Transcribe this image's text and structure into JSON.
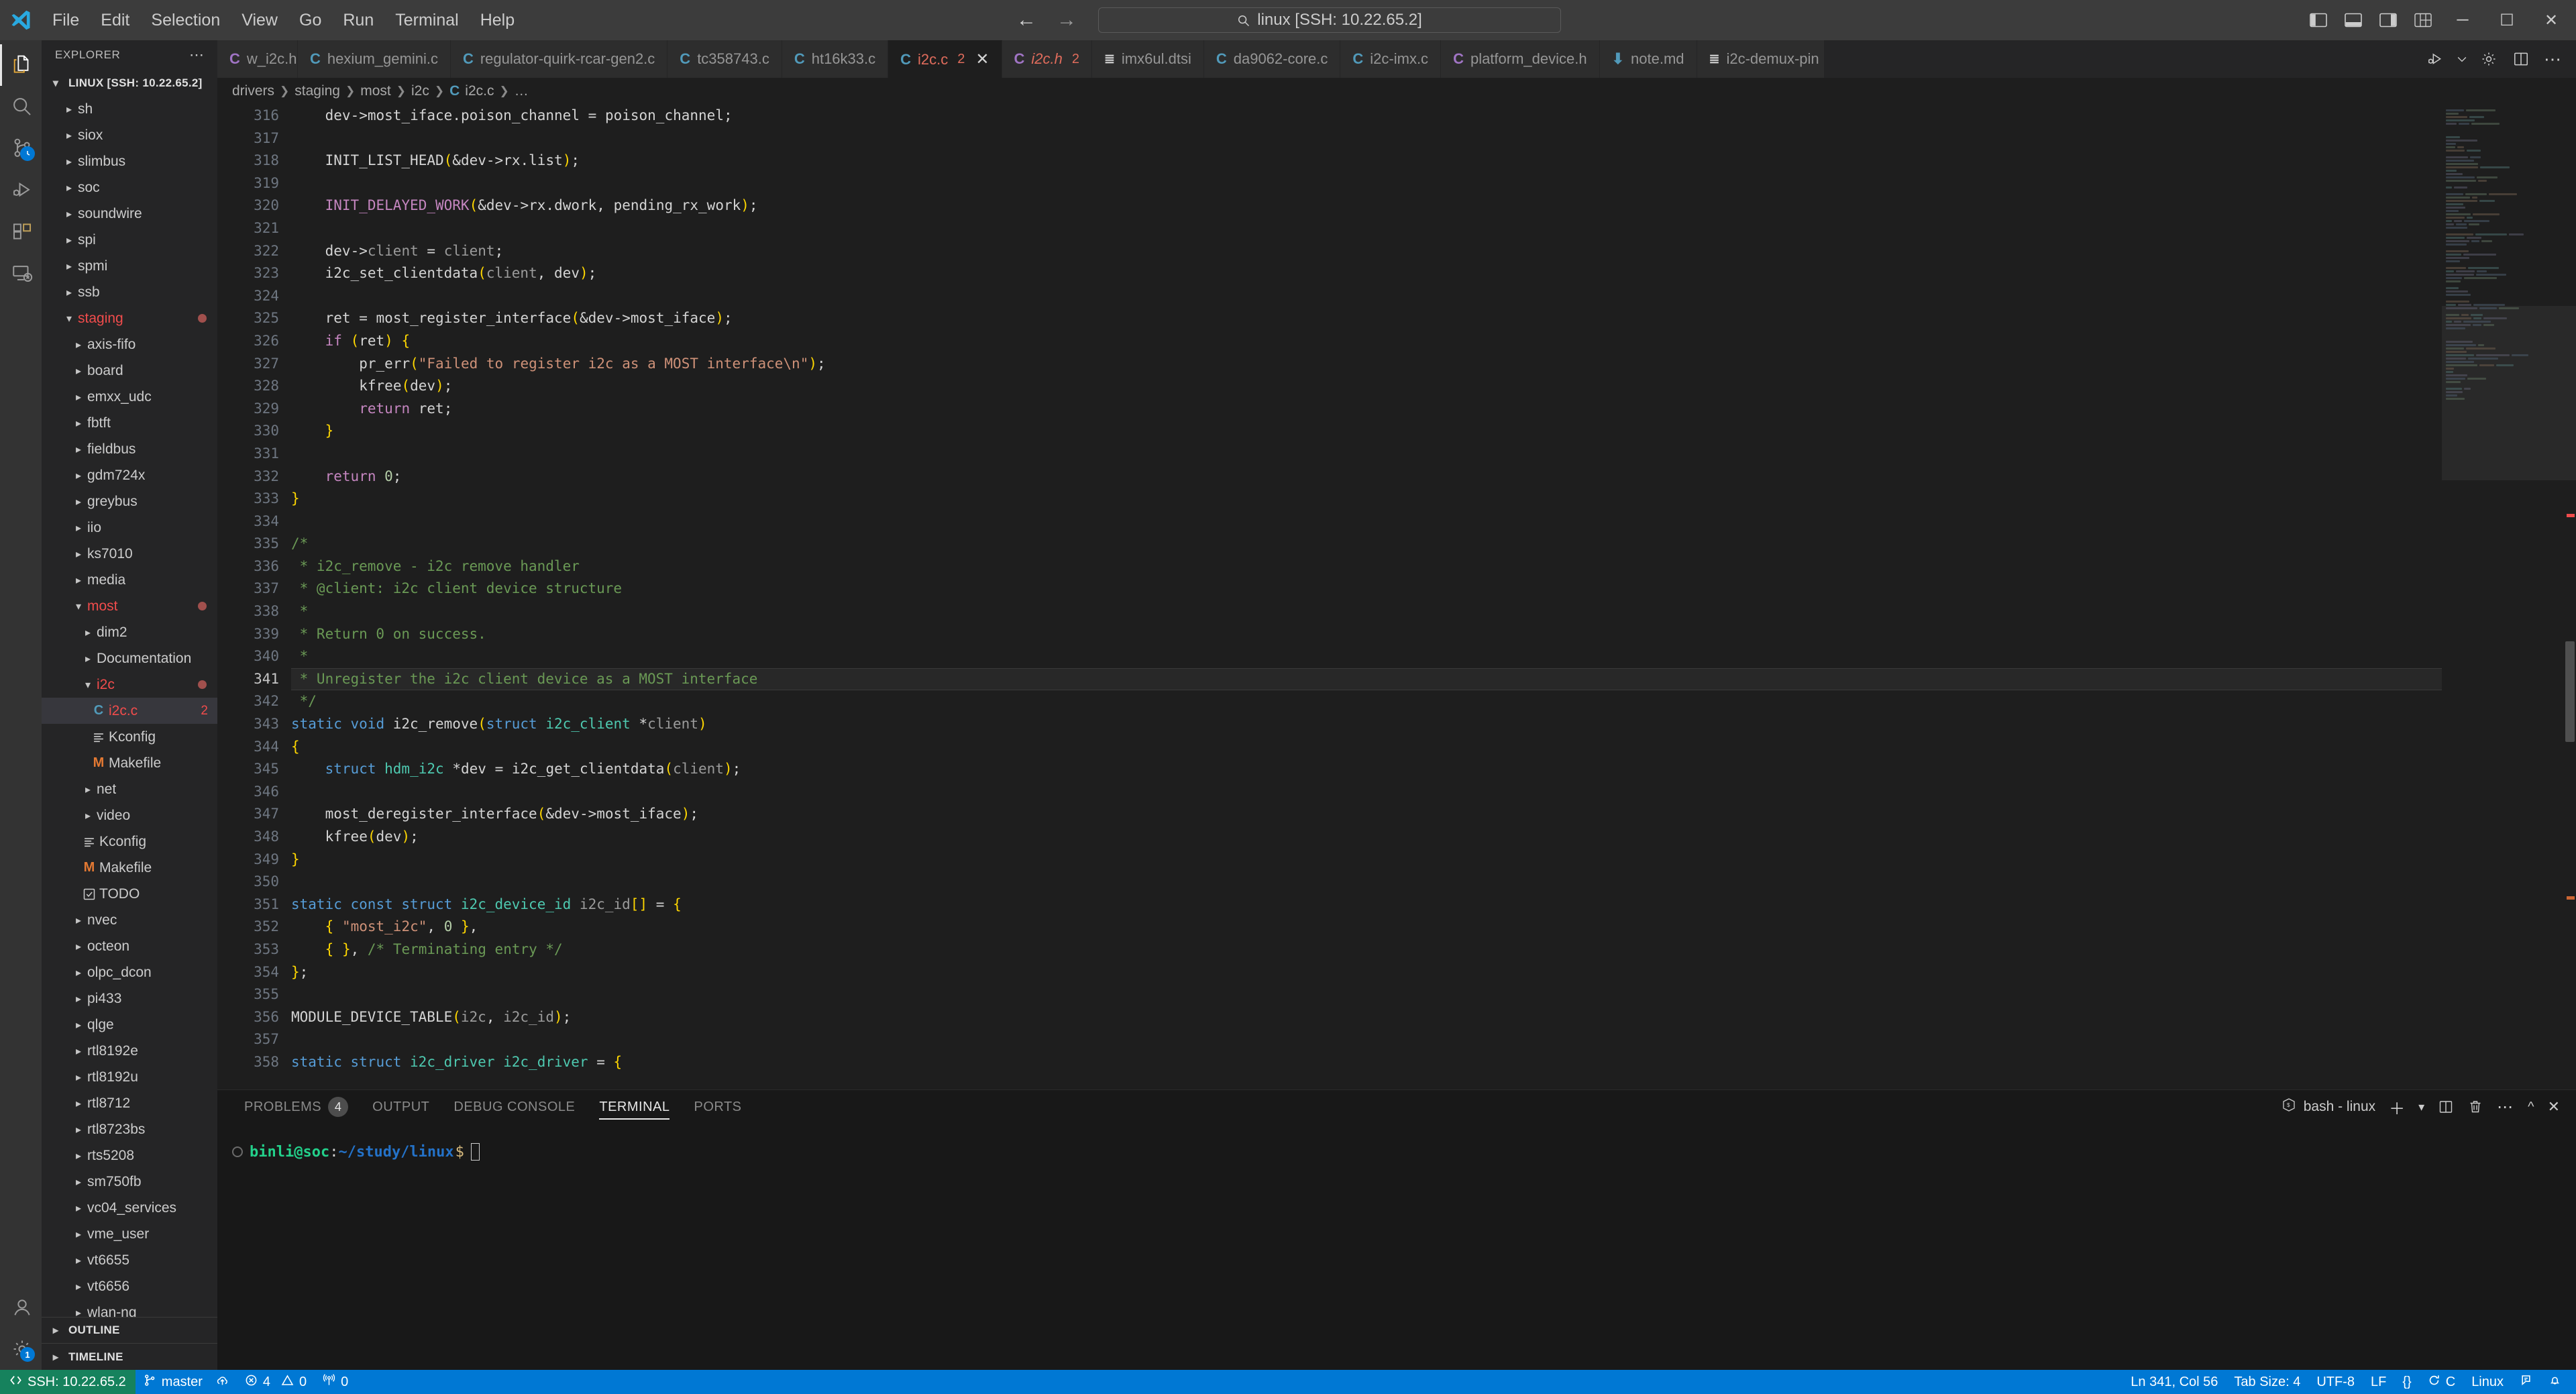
{
  "window": {
    "quick_pick_value": "linux [SSH: 10.22.65.2]",
    "menu": [
      "File",
      "Edit",
      "Selection",
      "View",
      "Go",
      "Run",
      "Terminal",
      "Help"
    ],
    "nav_back_icon": "arrow-left-icon",
    "nav_forward_icon": "arrow-right-icon",
    "minimize_label": "─",
    "maximize_label": "☐",
    "close_label": "✕"
  },
  "activitybar": {
    "items": [
      {
        "name": "explorer",
        "icon": "files-icon",
        "active": true,
        "badge": ""
      },
      {
        "name": "search",
        "icon": "search-icon",
        "active": false,
        "badge": ""
      },
      {
        "name": "source-control",
        "icon": "source-control-icon",
        "active": false,
        "badge": ""
      },
      {
        "name": "run-and-debug",
        "icon": "run-debug-icon",
        "active": false,
        "badge": ""
      },
      {
        "name": "extensions",
        "icon": "extensions-icon",
        "active": false,
        "badge": ""
      },
      {
        "name": "remote-explorer",
        "icon": "remote-explorer-icon",
        "active": false,
        "badge": ""
      }
    ],
    "bottom_items": [
      {
        "name": "accounts",
        "icon": "account-icon",
        "badge": ""
      },
      {
        "name": "manage",
        "icon": "gear-icon",
        "badge": "1"
      }
    ]
  },
  "sidebar": {
    "title": "EXPLORER",
    "more_actions": "⋯",
    "root_label": "LINUX [SSH: 10.22.65.2]",
    "outline_label": "OUTLINE",
    "timeline_label": "TIMELINE",
    "tree": [
      {
        "label": "sh",
        "depth": 1,
        "type": "folder",
        "state": "collapsed"
      },
      {
        "label": "siox",
        "depth": 1,
        "type": "folder",
        "state": "collapsed"
      },
      {
        "label": "slimbus",
        "depth": 1,
        "type": "folder",
        "state": "collapsed"
      },
      {
        "label": "soc",
        "depth": 1,
        "type": "folder",
        "state": "collapsed"
      },
      {
        "label": "soundwire",
        "depth": 1,
        "type": "folder",
        "state": "collapsed"
      },
      {
        "label": "spi",
        "depth": 1,
        "type": "folder",
        "state": "collapsed"
      },
      {
        "label": "spmi",
        "depth": 1,
        "type": "folder",
        "state": "collapsed"
      },
      {
        "label": "ssb",
        "depth": 1,
        "type": "folder",
        "state": "collapsed"
      },
      {
        "label": "staging",
        "depth": 1,
        "type": "folder",
        "state": "expanded",
        "error": true,
        "dot": true
      },
      {
        "label": "axis-fifo",
        "depth": 2,
        "type": "folder",
        "state": "collapsed"
      },
      {
        "label": "board",
        "depth": 2,
        "type": "folder",
        "state": "collapsed"
      },
      {
        "label": "emxx_udc",
        "depth": 2,
        "type": "folder",
        "state": "collapsed"
      },
      {
        "label": "fbtft",
        "depth": 2,
        "type": "folder",
        "state": "collapsed"
      },
      {
        "label": "fieldbus",
        "depth": 2,
        "type": "folder",
        "state": "collapsed"
      },
      {
        "label": "gdm724x",
        "depth": 2,
        "type": "folder",
        "state": "collapsed"
      },
      {
        "label": "greybus",
        "depth": 2,
        "type": "folder",
        "state": "collapsed"
      },
      {
        "label": "iio",
        "depth": 2,
        "type": "folder",
        "state": "collapsed"
      },
      {
        "label": "ks7010",
        "depth": 2,
        "type": "folder",
        "state": "collapsed"
      },
      {
        "label": "media",
        "depth": 2,
        "type": "folder",
        "state": "collapsed"
      },
      {
        "label": "most",
        "depth": 2,
        "type": "folder",
        "state": "expanded",
        "error": true,
        "dot": true
      },
      {
        "label": "dim2",
        "depth": 3,
        "type": "folder",
        "state": "collapsed"
      },
      {
        "label": "Documentation",
        "depth": 3,
        "type": "folder",
        "state": "collapsed"
      },
      {
        "label": "i2c",
        "depth": 3,
        "type": "folder",
        "state": "expanded",
        "error": true,
        "dot": true
      },
      {
        "label": "i2c.c",
        "depth": 4,
        "type": "file",
        "icon": "c-file-icon",
        "error": true,
        "count": "2",
        "selected": true
      },
      {
        "label": "Kconfig",
        "depth": 4,
        "type": "file",
        "icon": "text-file-icon"
      },
      {
        "label": "Makefile",
        "depth": 4,
        "type": "file",
        "icon": "makefile-icon"
      },
      {
        "label": "net",
        "depth": 3,
        "type": "folder",
        "state": "collapsed"
      },
      {
        "label": "video",
        "depth": 3,
        "type": "folder",
        "state": "collapsed"
      },
      {
        "label": "Kconfig",
        "depth": 3,
        "type": "file",
        "icon": "text-file-icon"
      },
      {
        "label": "Makefile",
        "depth": 3,
        "type": "file",
        "icon": "makefile-icon"
      },
      {
        "label": "TODO",
        "depth": 3,
        "type": "file",
        "icon": "todo-icon"
      },
      {
        "label": "nvec",
        "depth": 2,
        "type": "folder",
        "state": "collapsed"
      },
      {
        "label": "octeon",
        "depth": 2,
        "type": "folder",
        "state": "collapsed"
      },
      {
        "label": "olpc_dcon",
        "depth": 2,
        "type": "folder",
        "state": "collapsed"
      },
      {
        "label": "pi433",
        "depth": 2,
        "type": "folder",
        "state": "collapsed"
      },
      {
        "label": "qlge",
        "depth": 2,
        "type": "folder",
        "state": "collapsed"
      },
      {
        "label": "rtl8192e",
        "depth": 2,
        "type": "folder",
        "state": "collapsed"
      },
      {
        "label": "rtl8192u",
        "depth": 2,
        "type": "folder",
        "state": "collapsed"
      },
      {
        "label": "rtl8712",
        "depth": 2,
        "type": "folder",
        "state": "collapsed"
      },
      {
        "label": "rtl8723bs",
        "depth": 2,
        "type": "folder",
        "state": "collapsed"
      },
      {
        "label": "rts5208",
        "depth": 2,
        "type": "folder",
        "state": "collapsed"
      },
      {
        "label": "sm750fb",
        "depth": 2,
        "type": "folder",
        "state": "collapsed"
      },
      {
        "label": "vc04_services",
        "depth": 2,
        "type": "folder",
        "state": "collapsed"
      },
      {
        "label": "vme_user",
        "depth": 2,
        "type": "folder",
        "state": "collapsed"
      },
      {
        "label": "vt6655",
        "depth": 2,
        "type": "folder",
        "state": "collapsed"
      },
      {
        "label": "vt6656",
        "depth": 2,
        "type": "folder",
        "state": "collapsed"
      },
      {
        "label": "wlan-ng",
        "depth": 2,
        "type": "folder",
        "state": "collapsed"
      }
    ]
  },
  "editor": {
    "tabs": [
      {
        "label": "w_i2c.h",
        "icon": "h-file-icon",
        "icon_class": "fi-h",
        "active": false,
        "truncated": true
      },
      {
        "label": "hexium_gemini.c",
        "icon": "c-file-icon",
        "icon_class": "fi-c",
        "active": false
      },
      {
        "label": "regulator-quirk-rcar-gen2.c",
        "icon": "c-file-icon",
        "icon_class": "fi-c",
        "active": false
      },
      {
        "label": "tc358743.c",
        "icon": "c-file-icon",
        "icon_class": "fi-c",
        "active": false
      },
      {
        "label": "ht16k33.c",
        "icon": "c-file-icon",
        "icon_class": "fi-c",
        "active": false
      },
      {
        "label": "i2c.c",
        "icon": "c-file-icon",
        "icon_class": "fi-c",
        "active": true,
        "error": true,
        "count": "2",
        "close": "✕"
      },
      {
        "label": "i2c.h",
        "icon": "h-file-icon",
        "icon_class": "fi-h",
        "active": false,
        "modified": true,
        "count": "2"
      },
      {
        "label": "imx6ul.dtsi",
        "icon": "dts-file-icon",
        "icon_class": "fi-dts",
        "active": false
      },
      {
        "label": "da9062-core.c",
        "icon": "c-file-icon",
        "icon_class": "fi-c",
        "active": false
      },
      {
        "label": "i2c-imx.c",
        "icon": "c-file-icon",
        "icon_class": "fi-c",
        "active": false
      },
      {
        "label": "platform_device.h",
        "icon": "h-file-icon",
        "icon_class": "fi-h",
        "active": false
      },
      {
        "label": "note.md",
        "icon": "md-file-icon",
        "icon_class": "fi-md",
        "active": false
      },
      {
        "label": "i2c-demux-pin",
        "icon": "dts-file-icon",
        "icon_class": "fi-dts",
        "active": false,
        "truncated": true
      }
    ],
    "tab_actions": [
      {
        "name": "run-or-debug-button",
        "icon": "run-debug-icon"
      },
      {
        "name": "run-dropdown-button",
        "icon": "chevron-down-icon"
      },
      {
        "name": "settings-button",
        "icon": "gear-icon"
      },
      {
        "name": "split-editor-button",
        "icon": "split-editor-icon"
      },
      {
        "name": "more-actions-button",
        "icon": "ellipsis-icon"
      }
    ],
    "breadcrumb": [
      "drivers",
      "staging",
      "most",
      "i2c",
      "i2c.c",
      "…"
    ],
    "first_line": 316,
    "highlight_line": 341,
    "lines": [
      {
        "n": 316,
        "text": "    dev->most_iface.poison_channel = poison_channel;"
      },
      {
        "n": 317,
        "text": ""
      },
      {
        "n": 318,
        "text": "    INIT_LIST_HEAD(&dev->rx.list);"
      },
      {
        "n": 319,
        "text": ""
      },
      {
        "n": 320,
        "text": "    INIT_DELAYED_WORK(&dev->rx.dwork, pending_rx_work);"
      },
      {
        "n": 321,
        "text": ""
      },
      {
        "n": 322,
        "text": "    dev->client = client;"
      },
      {
        "n": 323,
        "text": "    i2c_set_clientdata(client, dev);"
      },
      {
        "n": 324,
        "text": ""
      },
      {
        "n": 325,
        "text": "    ret = most_register_interface(&dev->most_iface);"
      },
      {
        "n": 326,
        "text": "    if (ret) {"
      },
      {
        "n": 327,
        "text": "        pr_err(\"Failed to register i2c as a MOST interface\\n\");"
      },
      {
        "n": 328,
        "text": "        kfree(dev);"
      },
      {
        "n": 329,
        "text": "        return ret;"
      },
      {
        "n": 330,
        "text": "    }"
      },
      {
        "n": 331,
        "text": ""
      },
      {
        "n": 332,
        "text": "    return 0;"
      },
      {
        "n": 333,
        "text": "}"
      },
      {
        "n": 334,
        "text": ""
      },
      {
        "n": 335,
        "text": "/*"
      },
      {
        "n": 336,
        "text": " * i2c_remove - i2c remove handler"
      },
      {
        "n": 337,
        "text": " * @client: i2c client device structure"
      },
      {
        "n": 338,
        "text": " *"
      },
      {
        "n": 339,
        "text": " * Return 0 on success."
      },
      {
        "n": 340,
        "text": " *"
      },
      {
        "n": 341,
        "text": " * Unregister the i2c client device as a MOST interface"
      },
      {
        "n": 342,
        "text": " */"
      },
      {
        "n": 343,
        "text": "static void i2c_remove(struct i2c_client *client)"
      },
      {
        "n": 344,
        "text": "{"
      },
      {
        "n": 345,
        "text": "    struct hdm_i2c *dev = i2c_get_clientdata(client);"
      },
      {
        "n": 346,
        "text": ""
      },
      {
        "n": 347,
        "text": "    most_deregister_interface(&dev->most_iface);"
      },
      {
        "n": 348,
        "text": "    kfree(dev);"
      },
      {
        "n": 349,
        "text": "}"
      },
      {
        "n": 350,
        "text": ""
      },
      {
        "n": 351,
        "text": "static const struct i2c_device_id i2c_id[] = {"
      },
      {
        "n": 352,
        "text": "    { \"most_i2c\", 0 },"
      },
      {
        "n": 353,
        "text": "    { }, /* Terminating entry */"
      },
      {
        "n": 354,
        "text": "};"
      },
      {
        "n": 355,
        "text": ""
      },
      {
        "n": 356,
        "text": "MODULE_DEVICE_TABLE(i2c, i2c_id);"
      },
      {
        "n": 357,
        "text": ""
      },
      {
        "n": 358,
        "text": "static struct i2c_driver i2c_driver = {"
      }
    ]
  },
  "panel": {
    "tabs": [
      {
        "label": "PROBLEMS",
        "badge": "4",
        "active": false
      },
      {
        "label": "OUTPUT",
        "badge": "",
        "active": false
      },
      {
        "label": "DEBUG CONSOLE",
        "badge": "",
        "active": false
      },
      {
        "label": "TERMINAL",
        "badge": "",
        "active": true
      },
      {
        "label": "PORTS",
        "badge": "",
        "active": false
      }
    ],
    "terminal_selector": "bash - linux",
    "actions": [
      {
        "name": "new-terminal-button",
        "icon": "plus-icon"
      },
      {
        "name": "terminal-dropdown-button",
        "icon": "chevron-down-icon"
      },
      {
        "name": "split-terminal-button",
        "icon": "split-icon"
      },
      {
        "name": "kill-terminal-button",
        "icon": "trash-icon"
      },
      {
        "name": "panel-more-actions-button",
        "icon": "ellipsis-icon"
      },
      {
        "name": "maximize-panel-button",
        "icon": "chevron-up-icon"
      },
      {
        "name": "close-panel-button",
        "icon": "close-icon"
      }
    ],
    "terminal": {
      "user_host": "binli@soc",
      "separator": ":",
      "path": "~/study/linux",
      "prompt": "$"
    }
  },
  "statusbar": {
    "left": [
      {
        "name": "remote-indicator",
        "icon": "remote-icon",
        "label": "SSH: 10.22.65.2",
        "remote": true
      },
      {
        "name": "git-branch",
        "icon": "branch-icon",
        "label": "master"
      },
      {
        "name": "sync-changes",
        "icon": "sync-cloud-icon",
        "label": ""
      },
      {
        "name": "errors-warnings",
        "icon": "error-icon",
        "label": "4",
        "icon2": "warning-icon",
        "label2": "0"
      },
      {
        "name": "ports-forwarded",
        "icon": "radio-tower-icon",
        "label": "0"
      }
    ],
    "right": [
      {
        "name": "editor-position",
        "label": "Ln 341, Col 56"
      },
      {
        "name": "tab-size",
        "label": "Tab Size: 4"
      },
      {
        "name": "encoding",
        "label": "UTF-8"
      },
      {
        "name": "eol",
        "label": "LF"
      },
      {
        "name": "indent-brackets",
        "label": "{}"
      },
      {
        "name": "c-intellisense-status",
        "icon": "sync-icon",
        "label": "C"
      },
      {
        "name": "platform",
        "label": "Linux"
      },
      {
        "name": "remote-feedback",
        "icon": "feedback-icon",
        "label": ""
      },
      {
        "name": "notifications",
        "icon": "bell-icon",
        "label": ""
      }
    ]
  },
  "colors": {
    "accent": "#0078d4",
    "remote_green": "#16825d",
    "error_red": "#f14c4c",
    "modified_orange": "#e06c5c",
    "comment_green": "#6a9955",
    "string_orange": "#ce9178",
    "keyword_blue": "#569cd6",
    "control_purple": "#c586c0",
    "type_teal": "#4ec9b0",
    "variable_blue": "#9cdcfe"
  }
}
